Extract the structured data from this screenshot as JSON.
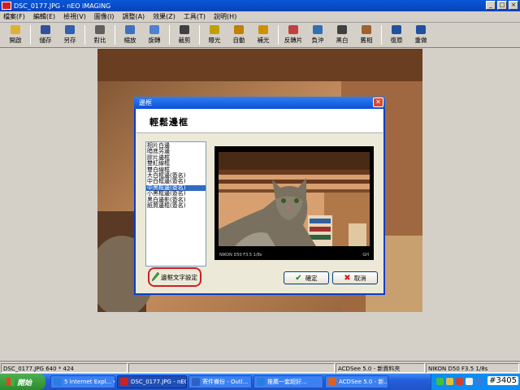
{
  "window": {
    "title": "DSC_0177.JPG - nEO iMAGING"
  },
  "menu": [
    "檔案(F)",
    "編輯(E)",
    "檢視(V)",
    "圖像(I)",
    "調整(A)",
    "效果(Z)",
    "工具(T)",
    "說明(H)"
  ],
  "toolbar": [
    {
      "label": "開啟",
      "icon": "open-folder-icon",
      "color": "#e0b030"
    },
    {
      "label": "儲存",
      "icon": "save-icon",
      "color": "#3050a0"
    },
    {
      "label": "另存",
      "icon": "save-as-icon",
      "color": "#3060b0"
    },
    {
      "label": "對比",
      "icon": "compare-icon",
      "color": "#606060"
    },
    {
      "label": "縮放",
      "icon": "zoom-icon",
      "color": "#4070c0"
    },
    {
      "label": "旋轉",
      "icon": "rotate-icon",
      "color": "#5080d0"
    },
    {
      "label": "裁剪",
      "icon": "crop-icon",
      "color": "#404040"
    },
    {
      "label": "曝光",
      "icon": "exposure-icon",
      "color": "#c0a000"
    },
    {
      "label": "自動",
      "icon": "auto-icon",
      "color": "#c08000"
    },
    {
      "label": "補光",
      "icon": "fill-light-icon",
      "color": "#d09000"
    },
    {
      "label": "反轉片",
      "icon": "reversal-film-icon",
      "color": "#c04040"
    },
    {
      "label": "負沖",
      "icon": "cross-process-icon",
      "color": "#3070b0"
    },
    {
      "label": "黑白",
      "icon": "black-white-icon",
      "color": "#404040"
    },
    {
      "label": "舊相",
      "icon": "sepia-icon",
      "color": "#a06030"
    },
    {
      "label": "復原",
      "icon": "undo-icon",
      "color": "#2050a0"
    },
    {
      "label": "重做",
      "icon": "redo-icon",
      "color": "#2050a0"
    }
  ],
  "dialog": {
    "title": "邊框",
    "heading": "輕鬆邊框",
    "frames": [
      "相片白邊",
      "暗底另邊",
      "膠片邊框",
      "雙紅線框",
      "雙白線框",
      "大白框邊(簽名)",
      "中白框邊(簽名)",
      "中黑框邊(簽名)",
      "小黑框邊(簽名)",
      "黑白邊影(簽名)",
      "紙質邊框(簽名)"
    ],
    "selected_index": 7,
    "caption_left": "NIKON D50 F3.5 1/8s",
    "caption_right": "GH",
    "text_settings_label": "邊框文字設定",
    "ok_label": "確定",
    "cancel_label": "取消"
  },
  "status": {
    "file": "DSC_0177.JPG  640 * 424",
    "middle": "ACDSee 5.0 - 新資料夾",
    "exif": "NIKON D50 F3.5 1/8s"
  },
  "taskbar": {
    "start": "開始",
    "tasks": [
      {
        "label": "5 Internet Expl... ▾",
        "color": "#2a7de0"
      },
      {
        "label": "DSC_0177.JPG - nEO...",
        "color": "#d02020"
      },
      {
        "label": "寄件備份 - Outl...",
        "color": "#3060c0"
      },
      {
        "label": "推薦一套超好...",
        "color": "#2a7de0"
      },
      {
        "label": "ACDSee 5.0 - 新...",
        "color": "#e06020"
      }
    ]
  },
  "badge": "#3405"
}
